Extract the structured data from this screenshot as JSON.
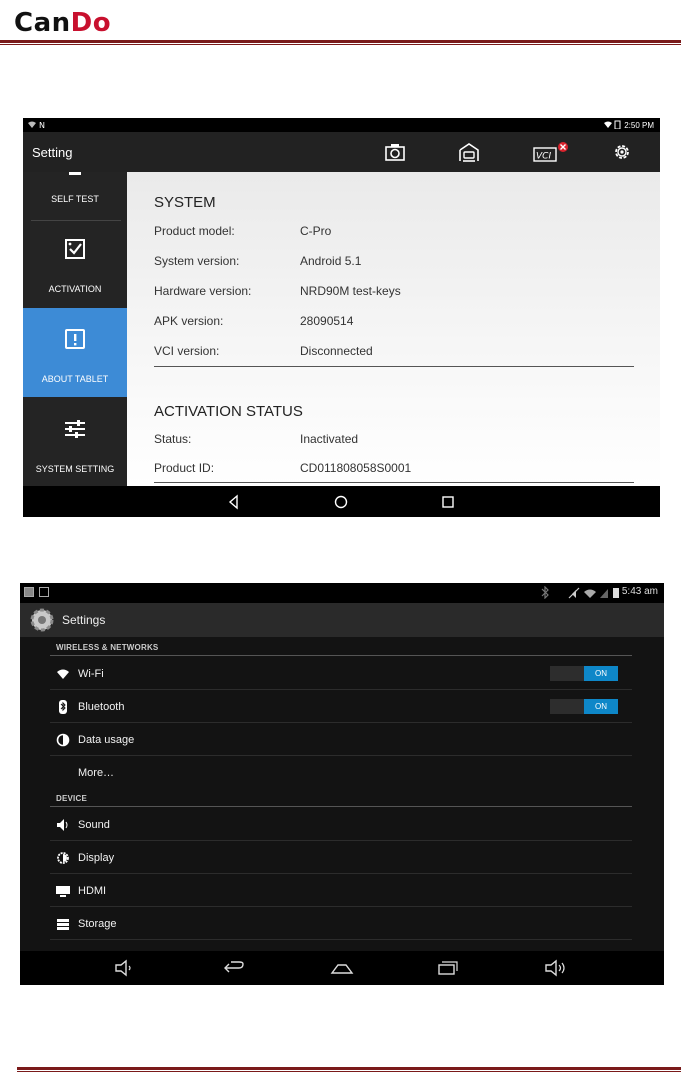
{
  "header": {
    "logo_part1": "Can",
    "logo_part2": "Do"
  },
  "shot1": {
    "status_bar": {
      "left": "N",
      "time": "2:50 PM"
    },
    "app_title": "Setting",
    "toolbar": {
      "vci_label": "VCI"
    },
    "sidebar": [
      {
        "label": "SELF TEST",
        "icon": "self-test-icon"
      },
      {
        "label": "ACTIVATION",
        "icon": "activation-check-icon"
      },
      {
        "label": "ABOUT TABLET",
        "icon": "exclamation-icon",
        "active": true
      },
      {
        "label": "SYSTEM SETTING",
        "icon": "sliders-icon"
      }
    ],
    "system": {
      "heading": "SYSTEM",
      "rows": [
        {
          "label": "Product model:",
          "value": "C-Pro"
        },
        {
          "label": "System version:",
          "value": "Android 5.1"
        },
        {
          "label": "Hardware version:",
          "value": "NRD90M test-keys"
        },
        {
          "label": "APK version:",
          "value": "28090514"
        },
        {
          "label": "VCI version:",
          "value": "Disconnected"
        }
      ]
    },
    "activation": {
      "heading": "ACTIVATION STATUS",
      "rows": [
        {
          "label": "Status:",
          "value": "Inactivated"
        },
        {
          "label": "Product ID:",
          "value": "CD011808058S0001"
        }
      ]
    }
  },
  "shot2": {
    "status_bar": {
      "time": "5:43 am"
    },
    "app_title": "Settings",
    "sections": [
      {
        "title": "WIRELESS & NETWORKS",
        "items": [
          {
            "label": "Wi-Fi",
            "icon": "wifi-icon",
            "toggle": "ON"
          },
          {
            "label": "Bluetooth",
            "icon": "bluetooth-icon",
            "toggle": "ON"
          },
          {
            "label": "Data usage",
            "icon": "data-usage-icon"
          },
          {
            "label": "More…",
            "icon": ""
          }
        ]
      },
      {
        "title": "DEVICE",
        "items": [
          {
            "label": "Sound",
            "icon": "sound-icon"
          },
          {
            "label": "Display",
            "icon": "display-icon"
          },
          {
            "label": "HDMI",
            "icon": "hdmi-icon"
          },
          {
            "label": "Storage",
            "icon": "storage-icon"
          }
        ]
      }
    ]
  },
  "colors": {
    "accent_blue": "#3d8bd6",
    "toggle_on": "#0e87c8",
    "rule": "#7a1a1a",
    "brand_red": "#c8102e"
  }
}
